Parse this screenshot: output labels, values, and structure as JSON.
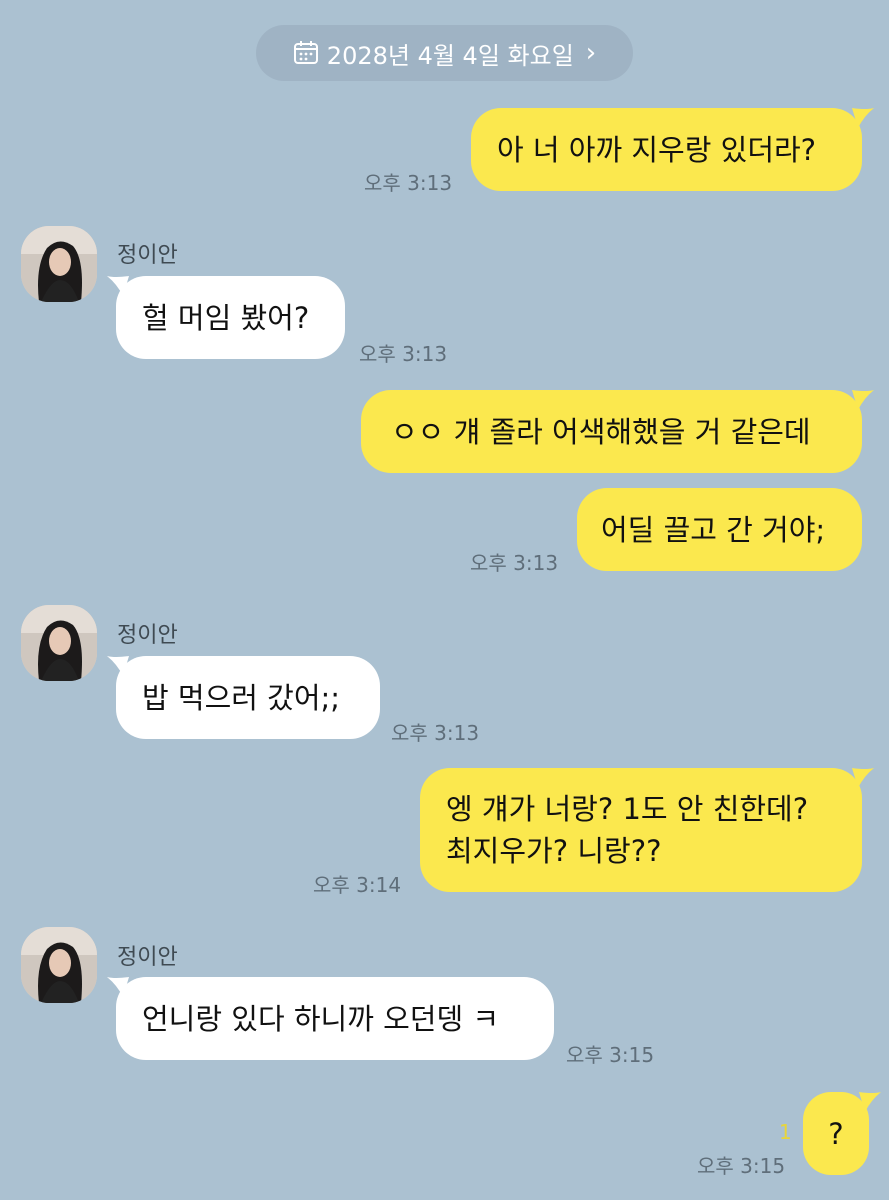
{
  "date_header": {
    "icon": "calendar-icon",
    "label": "2028년 4월 4일 화요일",
    "chevron": "›"
  },
  "contact": {
    "name": "정이안"
  },
  "messages": [
    {
      "from": "me",
      "text": "아 너 아까 지우랑 있더라?",
      "time": "오후 3:13"
    },
    {
      "from": "them",
      "text": "헐 머임 봤어?",
      "time": "오후 3:13"
    },
    {
      "from": "me",
      "text": "ㅇㅇ 걔 졸라 어색해했을 거 같은데",
      "time": ""
    },
    {
      "from": "me",
      "text": "어딜 끌고 간 거야;",
      "time": "오후 3:13"
    },
    {
      "from": "them",
      "text": "밥 먹으러 갔어;;",
      "time": "오후 3:13"
    },
    {
      "from": "me",
      "lines": [
        "엥 걔가 너랑? 1도 안 친한데?",
        "최지우가? 니랑??"
      ],
      "time": "오후 3:14"
    },
    {
      "from": "them",
      "text": "언니랑 있다 하니까 오던뎅 ㅋ",
      "time": "오후 3:15"
    },
    {
      "from": "me",
      "text": "?",
      "time": "오후 3:15",
      "unread": "1"
    }
  ],
  "colors": {
    "background": "#abc1d1",
    "my_bubble": "#fbe84e",
    "their_bubble": "#ffffff",
    "unread": "#e8d53a"
  }
}
